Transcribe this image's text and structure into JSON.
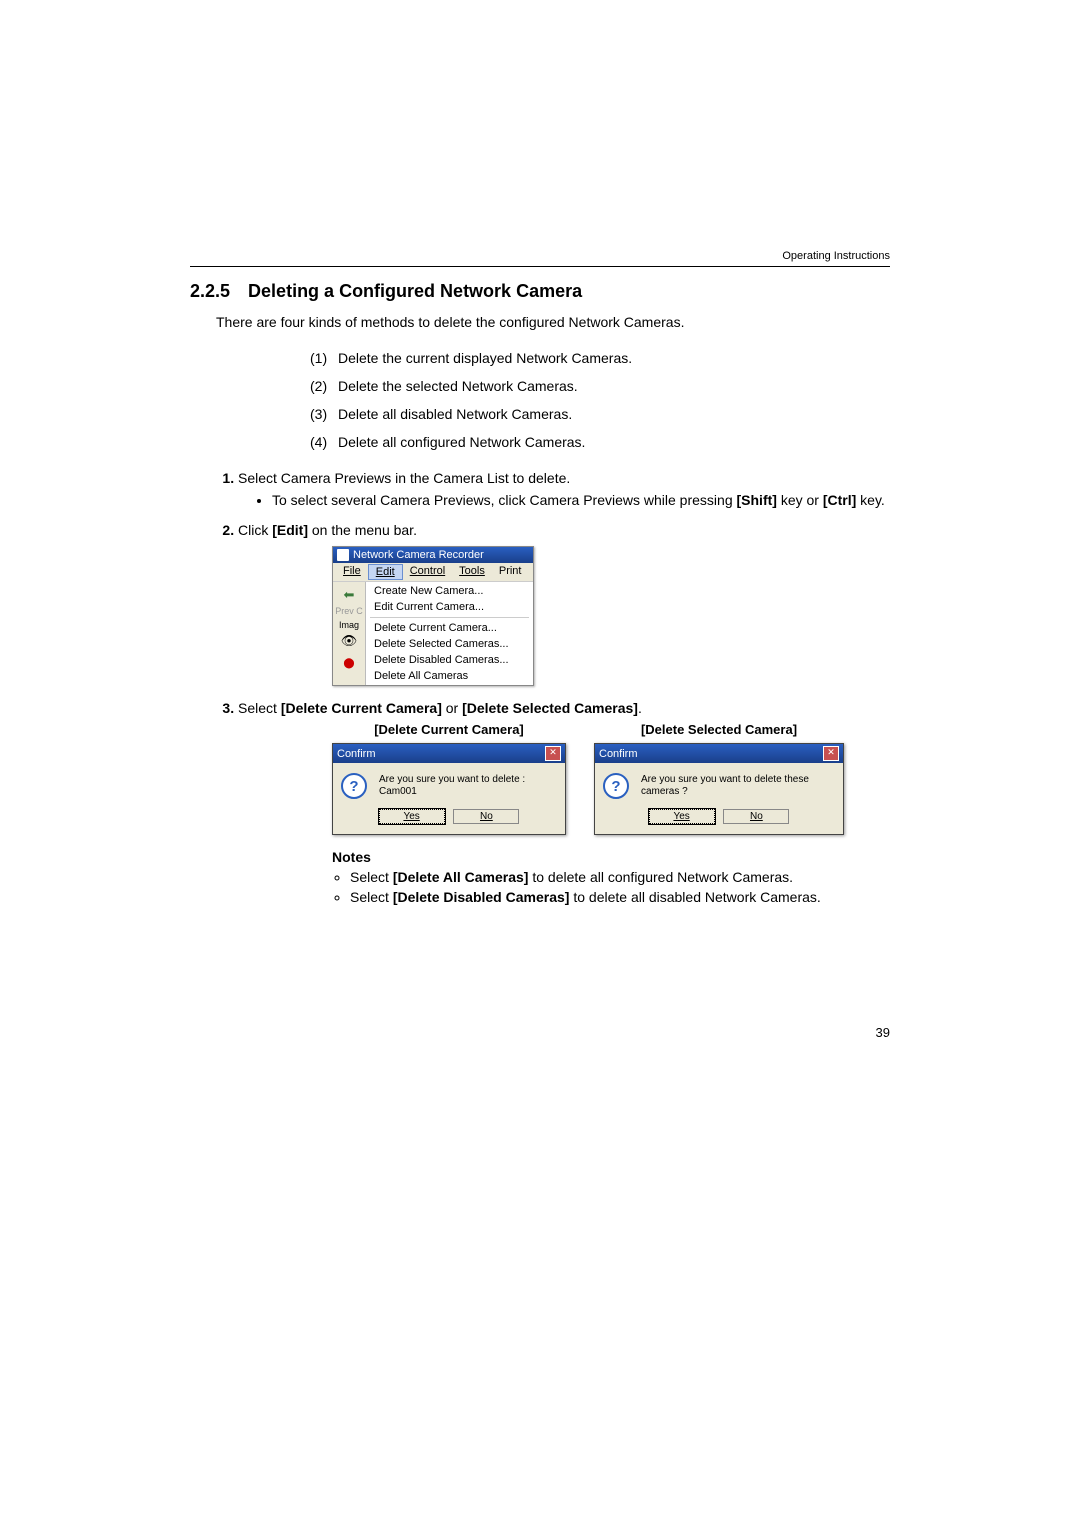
{
  "header": {
    "label": "Operating Instructions"
  },
  "section": {
    "number": "2.2.5",
    "title": "Deleting a Configured Network Camera"
  },
  "intro": "There are four kinds of methods to delete the configured Network Cameras.",
  "methods": [
    {
      "n": "(1)",
      "text": "Delete the current displayed Network Cameras."
    },
    {
      "n": "(2)",
      "text": "Delete the selected Network Cameras."
    },
    {
      "n": "(3)",
      "text": "Delete all disabled Network Cameras."
    },
    {
      "n": "(4)",
      "text": "Delete all configured Network Cameras."
    }
  ],
  "steps": {
    "s1": {
      "text": "Select Camera Previews in the Camera List to delete.",
      "sub_pre": "To select several Camera Previews, click Camera Previews while pressing ",
      "shift": "[Shift]",
      "mid": " key or ",
      "ctrl": "[Ctrl]",
      "suf": " key."
    },
    "s2": {
      "pre": "Click ",
      "bold": "[Edit]",
      "suf": " on the menu bar."
    },
    "s3": {
      "pre": "Select ",
      "b1": "[Delete Current Camera]",
      "mid": " or ",
      "b2": "[Delete Selected Cameras]",
      "suf": "."
    }
  },
  "menu": {
    "title": "Network Camera Recorder",
    "bar": [
      "File",
      "Edit",
      "Control",
      "Tools",
      "Print"
    ],
    "side": {
      "prev": "Prev C",
      "imag": "Imag"
    },
    "drop": [
      "Create New Camera...",
      "Edit Current Camera...",
      "Delete Current Camera...",
      "Delete Selected Cameras...",
      "Delete Disabled Cameras...",
      "Delete All Cameras"
    ]
  },
  "dialogs": {
    "left_label": "[Delete Current Camera]",
    "right_label": "[Delete Selected Camera]",
    "title": "Confirm",
    "left_msg": "Are you sure you want to delete : Cam001",
    "right_msg": "Are you sure you want to delete these cameras ?",
    "yes": "Yes",
    "no": "No"
  },
  "notes": {
    "heading": "Notes",
    "n1_pre": "Select ",
    "n1_b": "[Delete All Cameras]",
    "n1_suf": " to delete all configured Network Cameras.",
    "n2_pre": "Select ",
    "n2_b": "[Delete Disabled Cameras]",
    "n2_suf": " to delete all disabled Network Cameras."
  },
  "page_number": "39"
}
